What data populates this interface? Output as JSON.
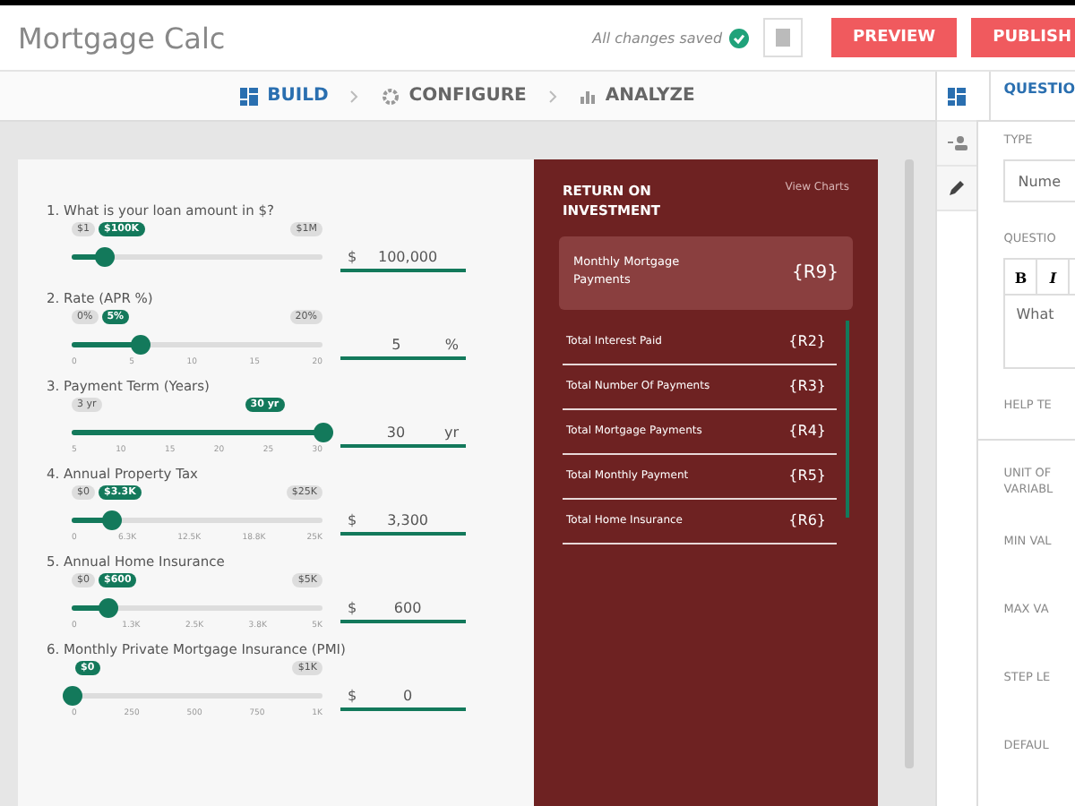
{
  "header": {
    "title": "Mortgage Calc",
    "save_status": "All changes saved",
    "buttons": [
      "PREVIEW",
      "PUBLISH"
    ]
  },
  "steps": [
    {
      "label": "BUILD",
      "selected": true,
      "kind": "build"
    },
    {
      "label": "CONFIGURE",
      "selected": false,
      "kind": "configure"
    },
    {
      "label": "ANALYZE",
      "selected": false,
      "kind": "analyze"
    }
  ],
  "questions": [
    {
      "number": "1.",
      "label": "What is your loan amount in $?",
      "min": "$1",
      "bubble": "$100K",
      "max": "$1M",
      "level": 0.13,
      "prefix": "$",
      "value": "100,000"
    },
    {
      "number": "2.",
      "label": "Rate (APR %)",
      "min": "0%",
      "bubble": "5%",
      "max": "20%",
      "level": 0.27,
      "ticks": [
        "0",
        "5",
        "10",
        "15",
        "20"
      ],
      "value": "5",
      "suffix": "%"
    },
    {
      "number": "3.",
      "label": "Payment Term (Years)",
      "min": "3 yr",
      "bubble": "30 yr",
      "level": 1,
      "ticks": [
        "5",
        "10",
        "15",
        "20",
        "25",
        "30"
      ],
      "value": "30",
      "suffix": "yr"
    },
    {
      "number": "4.",
      "label": "Annual Property Tax",
      "min": "$0",
      "bubble": "$3.3K",
      "max": "$25K",
      "level": 0.16,
      "ticks": [
        "0",
        "6.3K",
        "12.5K",
        "18.8K",
        "25K"
      ],
      "prefix": "$",
      "value": "3,300"
    },
    {
      "number": "5.",
      "label": "Annual Home Insurance",
      "min": "$0",
      "bubble": "$600",
      "max": "$5K",
      "level": 0.14,
      "ticks": [
        "0",
        "1.3K",
        "2.5K",
        "3.8K",
        "5K"
      ],
      "prefix": "$",
      "value": "600"
    },
    {
      "number": "6.",
      "label": "Monthly Private Mortgage Insurance (PMI)",
      "bubble": "$0",
      "max": "$1K",
      "level": 0,
      "ticks": [
        "0",
        "250",
        "500",
        "750",
        "1K"
      ],
      "prefix": "$",
      "value": "0"
    }
  ],
  "results": {
    "title": "RETURN ON INVESTMENT",
    "link": "View Charts",
    "highlight": {
      "label": "Monthly Mortgage Payments",
      "token": "{R9}"
    },
    "rows": [
      {
        "label": "Total Interest Paid",
        "token": "{R2}"
      },
      {
        "label": "Total Number Of Payments",
        "token": "{R3}"
      },
      {
        "label": "Total Mortgage Payments",
        "token": "{R4}"
      },
      {
        "label": "Total Monthly Payment",
        "token": "{R5}"
      },
      {
        "label": "Total Home Insurance",
        "token": "{R6}"
      }
    ]
  },
  "side_tabs": [
    {
      "kind": "grid",
      "selected": true
    },
    {
      "kind": "people",
      "selected": false
    },
    {
      "kind": "pencil",
      "selected": false
    }
  ],
  "panel": {
    "title": "QUESTIO",
    "type_label": "TYPE",
    "type_value": "Nume",
    "question_label": "QUESTIO",
    "editor_buttons": [
      "B",
      "I"
    ],
    "editor_text": "What",
    "help_label": "HELP TE",
    "fields": [
      "UNIT OF\nVARIABL",
      "MIN VAL",
      "MAX VA",
      "STEP LE",
      "DEFAUL"
    ]
  }
}
